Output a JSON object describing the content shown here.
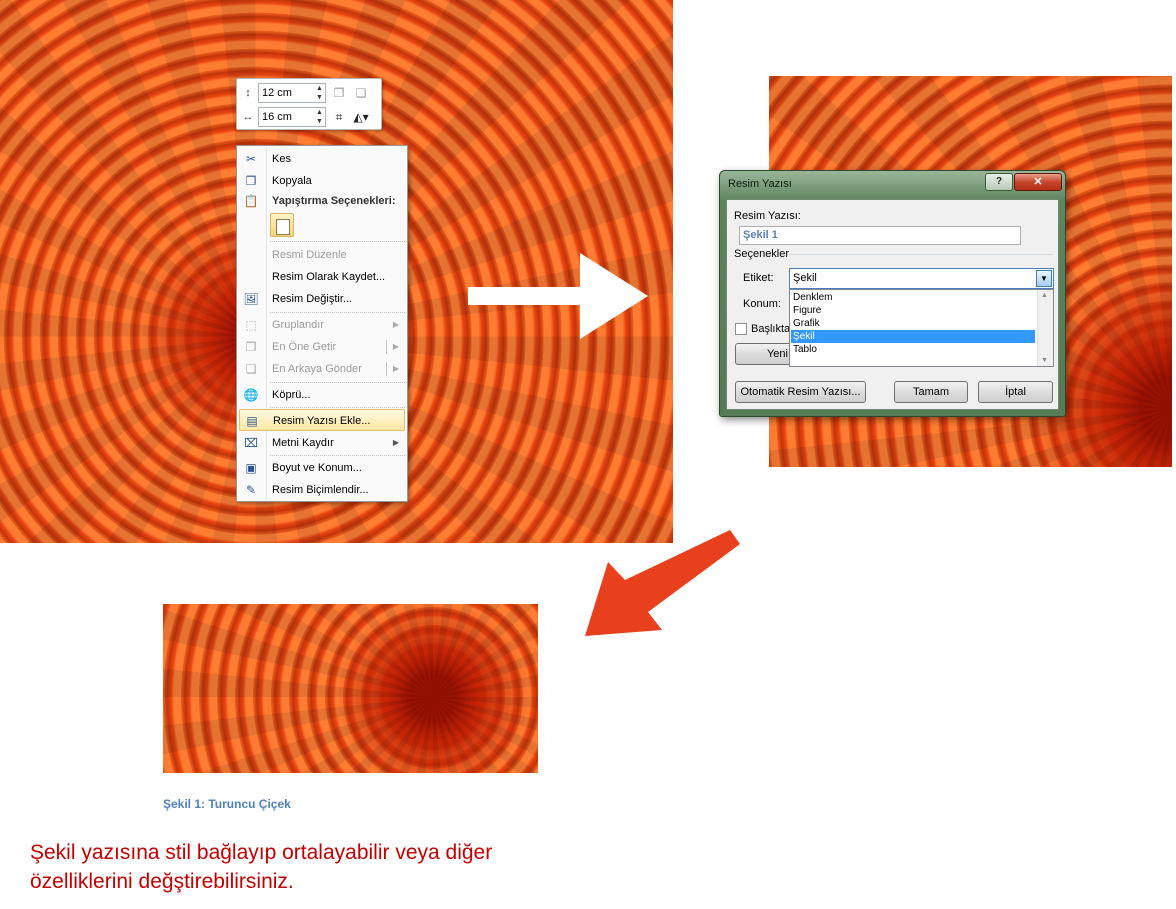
{
  "mini_toolbar": {
    "height_value": "12 cm",
    "width_value": "16 cm",
    "icons": [
      "height-icon",
      "width-icon",
      "bring-forward-icon",
      "send-backward-icon",
      "crop-icon",
      "shape-outline-icon"
    ]
  },
  "context_menu": {
    "items": [
      {
        "label": "Kes",
        "icon": "scissors-icon",
        "enabled": true
      },
      {
        "label": "Kopyala",
        "icon": "copy-icon",
        "enabled": true
      },
      {
        "label": "Yapıştırma Seçenekleri:",
        "icon": "paste-icon",
        "enabled": true,
        "header": true
      },
      {
        "label": "Resmi Düzenle",
        "enabled": false
      },
      {
        "label": "Resim Olarak Kaydet...",
        "enabled": true
      },
      {
        "label": "Resim Değiştir...",
        "icon": "change-picture-icon",
        "enabled": true
      },
      {
        "label": "Gruplandır",
        "icon": "group-icon",
        "enabled": false,
        "submenu": true
      },
      {
        "label": "En Öne Getir",
        "icon": "bring-to-front-icon",
        "enabled": false,
        "submenu": true
      },
      {
        "label": "En Arkaya Gönder",
        "icon": "send-to-back-icon",
        "enabled": false,
        "submenu": true
      },
      {
        "label": "Köprü...",
        "icon": "hyperlink-icon",
        "enabled": true
      },
      {
        "label": "Resim Yazısı Ekle...",
        "icon": "insert-caption-icon",
        "enabled": true,
        "highlighted": true
      },
      {
        "label": "Metni Kaydır",
        "icon": "wrap-text-icon",
        "enabled": true,
        "submenu": true
      },
      {
        "label": "Boyut ve Konum...",
        "icon": "size-position-icon",
        "enabled": true
      },
      {
        "label": "Resim Biçimlendir...",
        "icon": "format-picture-icon",
        "enabled": true
      }
    ]
  },
  "dialog": {
    "title": "Resim Yazısı",
    "help": "?",
    "close": "✕",
    "caption_label": "Resim Yazısı:",
    "caption_value": "Şekil 1",
    "options_label": "Seçenekler",
    "label_label": "Etiket:",
    "label_value": "Şekil",
    "position_label": "Konum:",
    "exclude_label": "Başlıktan",
    "new_label_button": "Yeni",
    "label_options": [
      "Denklem",
      "Figure",
      "Grafik",
      "Şekil",
      "Tablo"
    ],
    "selected_option": "Şekil",
    "autocaption_button": "Otomatik Resim Yazısı...",
    "ok_button": "Tamam",
    "cancel_button": "İptal"
  },
  "caption_text": "Şekil 1: Turuncu Çiçek",
  "note_text": "Şekil yazısına stil bağlayıp ortalayabilir veya diğer özelliklerini değştirebilirsiniz.",
  "colors": {
    "arrow_red": "#e8401c",
    "note_red": "#c00000",
    "caption_blue": "#4f81bd"
  }
}
